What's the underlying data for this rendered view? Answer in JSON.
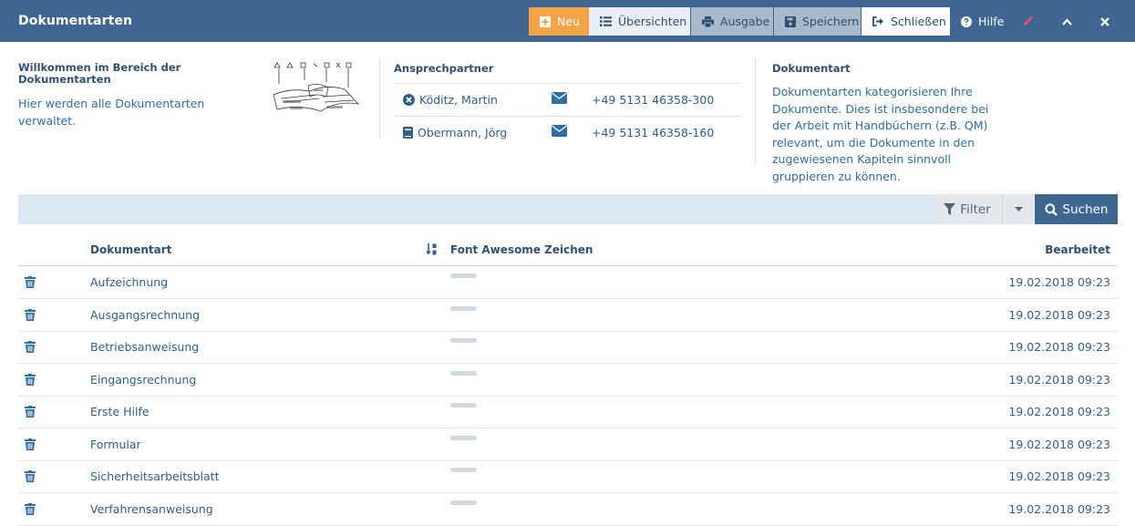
{
  "header": {
    "title": "Dokumentarten",
    "buttons": {
      "neu": "Neu",
      "uebersichten": "Übersichten",
      "ausgabe": "Ausgabe",
      "speichern": "Speichern",
      "schliessen": "Schließen",
      "hilfe": "Hilfe"
    }
  },
  "welcome": {
    "heading": "Willkommen im Bereich der Dokumentarten",
    "text": "Hier werden alle Dokumentarten verwaltet."
  },
  "contacts": {
    "heading": "Ansprechpartner",
    "items": [
      {
        "name": "Köditz, Martin",
        "phone": "+49 5131 46358-300",
        "icon": "times-circle-icon"
      },
      {
        "name": "Obermann, Jörg",
        "phone": "+49 5131 46358-160",
        "icon": "book-icon"
      }
    ]
  },
  "description": {
    "heading": "Dokumentart",
    "text": "Dokumentarten kategorisieren Ihre Dokumente. Dies ist insbesondere bei der Arbeit mit Handbüchern (z.B. QM) relevant, um die Dokumente in den zugewiesenen Kapiteln sinnvoll gruppieren zu können."
  },
  "search": {
    "filter_label": "Filter",
    "search_label": "Suchen"
  },
  "table": {
    "columns": {
      "name": "Dokumentart",
      "icon": "Font Awesome Zeichen",
      "edited": "Bearbeitet"
    },
    "rows": [
      {
        "name": "Aufzeichnung",
        "edited": "19.02.2018 09:23"
      },
      {
        "name": "Ausgangsrechnung",
        "edited": "19.02.2018 09:23"
      },
      {
        "name": "Betriebsanweisung",
        "edited": "19.02.2018 09:23"
      },
      {
        "name": "Eingangsrechnung",
        "edited": "19.02.2018 09:23"
      },
      {
        "name": "Erste Hilfe",
        "edited": "19.02.2018 09:23"
      },
      {
        "name": "Formular",
        "edited": "19.02.2018 09:23"
      },
      {
        "name": "Sicherheitsarbeitsblatt",
        "edited": "19.02.2018 09:23"
      },
      {
        "name": "Verfahrensanweisung",
        "edited": "19.02.2018 09:23"
      }
    ]
  },
  "colors": {
    "header_bg": "#3e6690",
    "accent_orange": "#f4a448",
    "text_blue": "#2f5f8a",
    "search_bg": "#dae9f4"
  }
}
